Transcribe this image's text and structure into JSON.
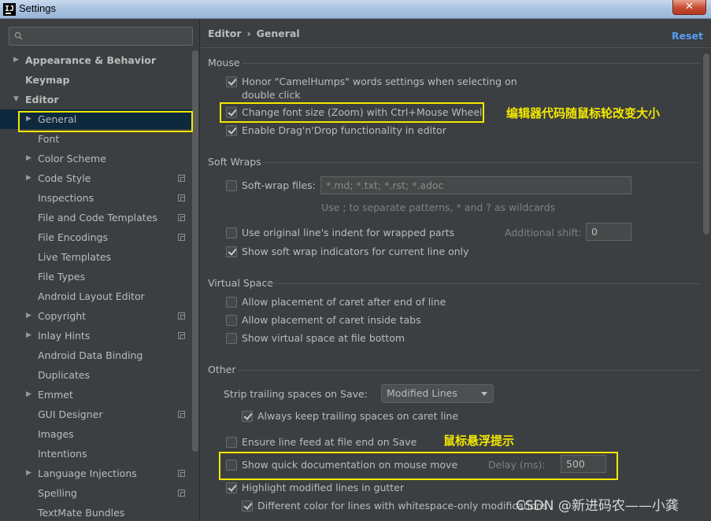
{
  "window": {
    "title": "Settings",
    "app_icon_text": "IJ",
    "close_label": "✕"
  },
  "search": {
    "placeholder": "",
    "value": ""
  },
  "sidebar": {
    "items": [
      {
        "label": "Appearance & Behavior",
        "arrow": "▶"
      },
      {
        "label": "Keymap"
      },
      {
        "label": "Editor",
        "arrow": "▼"
      },
      {
        "label": "General",
        "arrow": "▶"
      },
      {
        "label": "Font"
      },
      {
        "label": "Color Scheme",
        "arrow": "▶"
      },
      {
        "label": "Code Style",
        "arrow": "▶"
      },
      {
        "label": "Inspections"
      },
      {
        "label": "File and Code Templates"
      },
      {
        "label": "File Encodings"
      },
      {
        "label": "Live Templates"
      },
      {
        "label": "File Types"
      },
      {
        "label": "Android Layout Editor"
      },
      {
        "label": "Copyright",
        "arrow": "▶"
      },
      {
        "label": "Inlay Hints",
        "arrow": "▶"
      },
      {
        "label": "Android Data Binding"
      },
      {
        "label": "Duplicates"
      },
      {
        "label": "Emmet",
        "arrow": "▶"
      },
      {
        "label": "GUI Designer"
      },
      {
        "label": "Images"
      },
      {
        "label": "Intentions"
      },
      {
        "label": "Language Injections",
        "arrow": "▶"
      },
      {
        "label": "Spelling"
      },
      {
        "label": "TextMate Bundles"
      }
    ]
  },
  "header": {
    "crumb_parent": "Editor",
    "crumb_sep": "›",
    "crumb_current": "General",
    "reset_label": "Reset"
  },
  "mouse": {
    "title": "Mouse",
    "camelhumps_line1": "Honor \"CamelHumps\" words settings when selecting on",
    "camelhumps_line2": "double click",
    "zoom": "Change font size (Zoom) with Ctrl+Mouse Wheel",
    "dragdrop": "Enable Drag'n'Drop functionality in editor"
  },
  "soft_wraps": {
    "title": "Soft Wraps",
    "files_label": "Soft-wrap files:",
    "files_value": "*.md; *.txt; *.rst; *.adoc",
    "files_hint": "Use ; to separate patterns, * and ? as wildcards",
    "indent": "Use original line's indent for wrapped parts",
    "additional_shift_label": "Additional shift:",
    "additional_shift_value": "0",
    "indicators": "Show soft wrap indicators for current line only"
  },
  "virtual_space": {
    "title": "Virtual Space",
    "after_end": "Allow placement of caret after end of line",
    "inside_tabs": "Allow placement of caret inside tabs",
    "file_bottom": "Show virtual space at file bottom"
  },
  "other": {
    "title": "Other",
    "strip_label": "Strip trailing spaces on Save:",
    "strip_value": "Modified Lines",
    "keep_trailing": "Always keep trailing spaces on caret line",
    "line_feed": "Ensure line feed at file end on Save",
    "quick_doc": "Show quick documentation on mouse move",
    "delay_label": "Delay (ms):",
    "delay_value": "500",
    "highlight_modified": "Highlight modified lines in gutter",
    "different_color": "Different color for lines with whitespace-only modifications"
  },
  "annotations": {
    "zoom_note": "编辑器代码随鼠标轮改变大小",
    "quick_doc_note": "鼠标悬浮提示"
  },
  "watermark": "CSDN @新进码农——小龚",
  "colors": {
    "accent_link": "#589df6",
    "highlight_box": "#f2e800",
    "selection": "#0d293e"
  }
}
